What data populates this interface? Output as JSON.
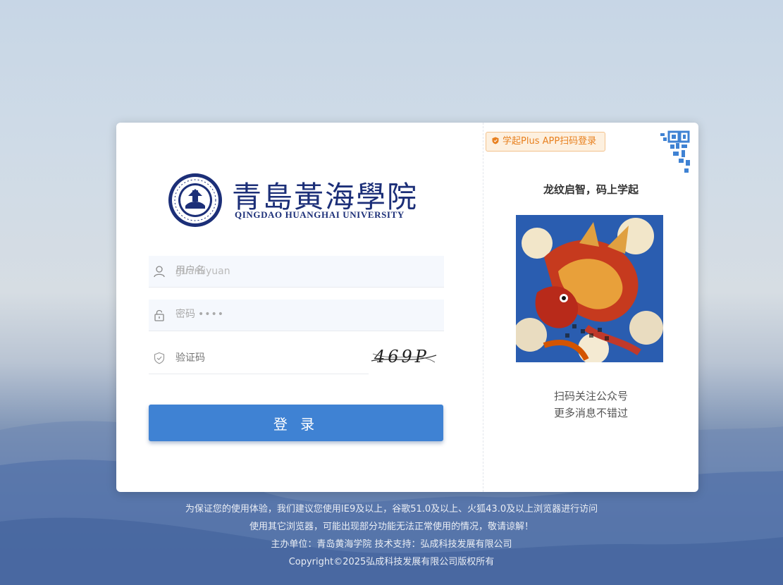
{
  "logo": {
    "name_cn": "青島黃海學院",
    "name_en": "QINGDAO HUANGHAI UNIVERSITY"
  },
  "form": {
    "username": {
      "placeholder": "用户名",
      "value": "guanliyuan",
      "icon": "user-icon"
    },
    "password": {
      "placeholder": "密码",
      "value": "••••",
      "icon": "lock-icon"
    },
    "captcha": {
      "placeholder": "验证码",
      "value": "",
      "icon": "shield-check-icon",
      "image_text": "469P"
    },
    "login_label": "登 录"
  },
  "right_panel": {
    "app_tag": "学起Plus APP扫码登录",
    "slogan": "龙纹启智，码上学起",
    "follow_line1": "扫码关注公众号",
    "follow_line2": "更多消息不错过"
  },
  "footer": {
    "line1": "为保证您的使用体验，我们建议您使用IE9及以上，谷歌51.0及以上、火狐43.0及以上浏览器进行访问",
    "line2": "使用其它浏览器，可能出现部分功能无法正常使用的情况，敬请谅解！",
    "line3": "主办单位：青岛黄海学院  技术支持：弘成科技发展有限公司",
    "line4": "Copyright©2025弘成科技发展有限公司版权所有"
  },
  "colors": {
    "primary": "#3f82d3",
    "brand_navy": "#1c2f78",
    "tag_orange": "#e8801f"
  }
}
